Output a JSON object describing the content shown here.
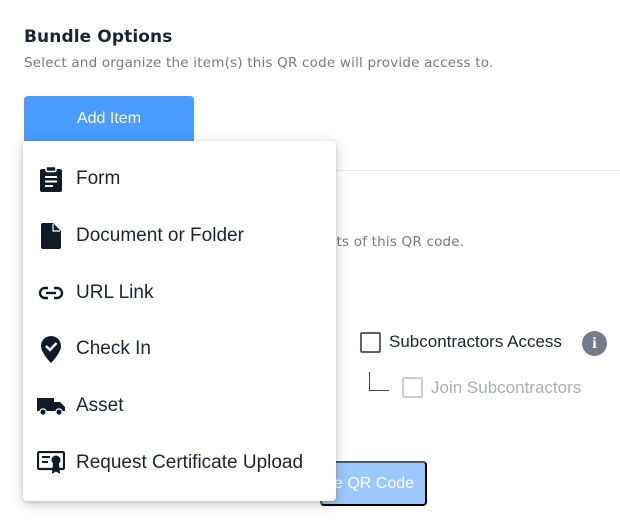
{
  "section": {
    "title": "Bundle Options",
    "subtitle": "Select and organize the item(s) this QR code will provide access to."
  },
  "add_item": {
    "label": "Add Item"
  },
  "background": {
    "contents_text": "ntents of this QR code."
  },
  "access": {
    "subcontractors_label": "Subcontractors Access",
    "info_glyph": "i",
    "join_label": "Join Subcontractors"
  },
  "qr_button": {
    "label": "e QR Code"
  },
  "menu": {
    "items": [
      {
        "label": "Form",
        "icon": "clipboard-icon"
      },
      {
        "label": "Document or Folder",
        "icon": "document-icon"
      },
      {
        "label": "URL Link",
        "icon": "link-icon"
      },
      {
        "label": "Check In",
        "icon": "location-check-icon"
      },
      {
        "label": "Asset",
        "icon": "truck-icon"
      },
      {
        "label": "Request Certificate Upload",
        "icon": "certificate-icon"
      }
    ]
  },
  "colors": {
    "primary": "#4a9bff",
    "primary_disabled": "#9dc8ff",
    "text_dark": "#1b2532",
    "text_muted": "#707b88",
    "icon_dark": "#111b27"
  }
}
